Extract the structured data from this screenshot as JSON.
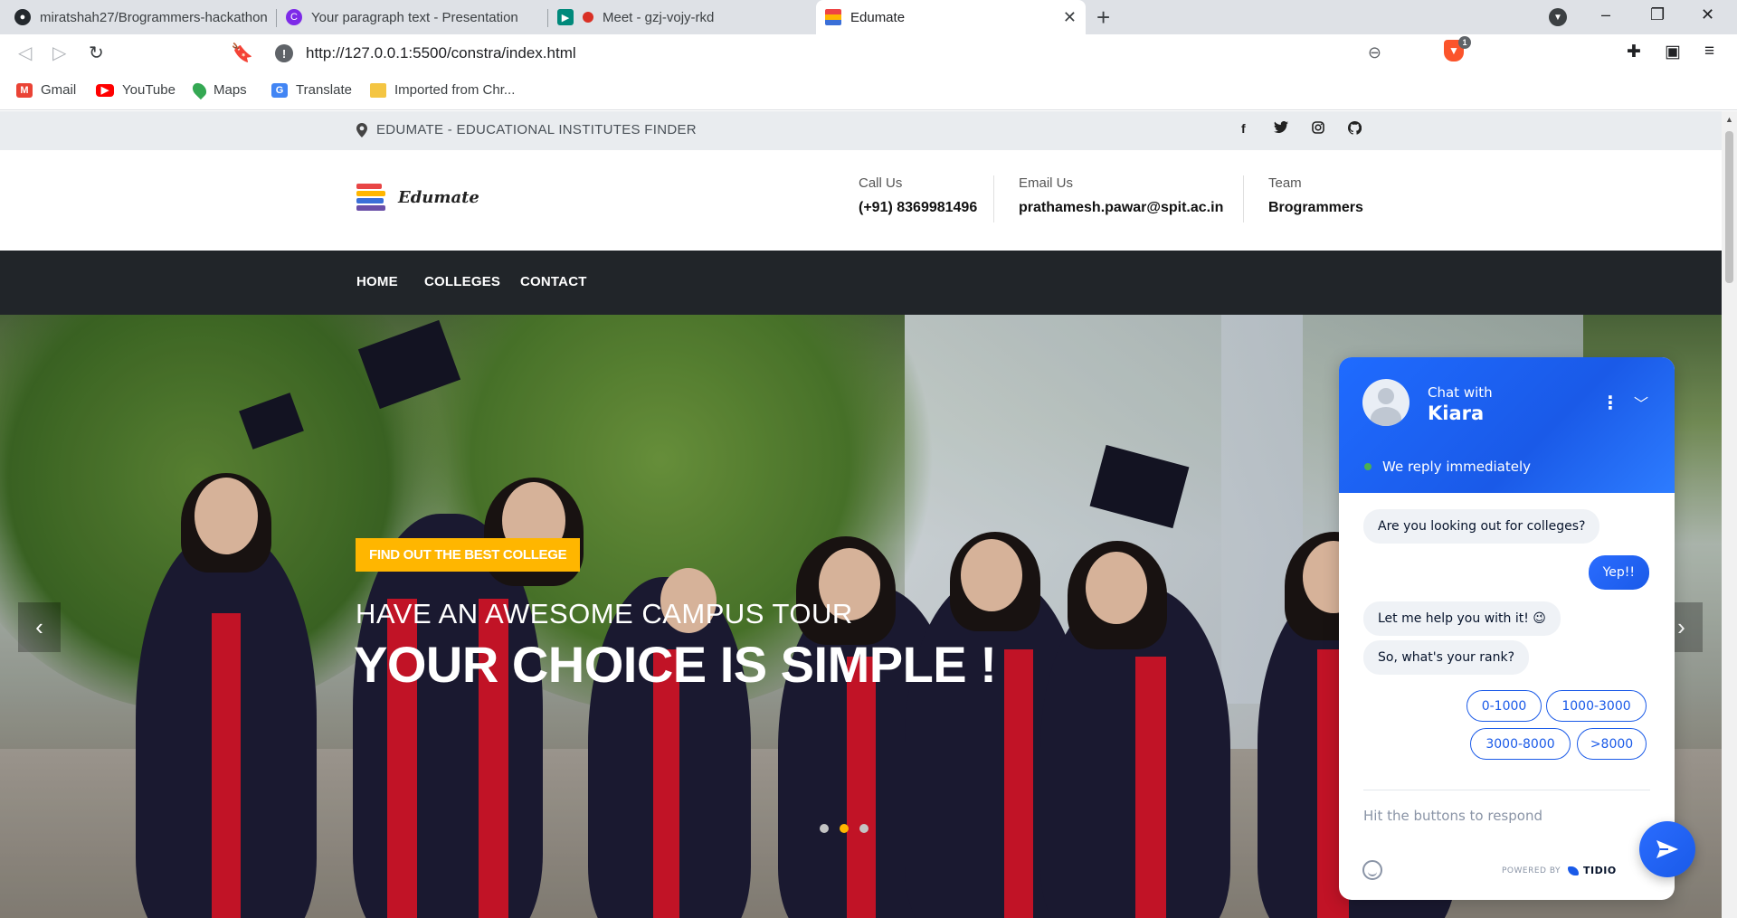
{
  "browser": {
    "tabs": [
      {
        "title": "miratshah27/Brogrammers-hackathon",
        "icon": "github-icon"
      },
      {
        "title": "Your paragraph text - Presentation",
        "icon": "canva-icon"
      },
      {
        "title": "Meet - gzj-vojy-rkd",
        "icon": "meet-icon"
      },
      {
        "title": "Edumate",
        "icon": "edumate-icon",
        "active": true
      }
    ],
    "new_tab": "+",
    "window_controls": {
      "minimize": "–",
      "restore": "❐",
      "close": "✕"
    },
    "url": "http://127.0.0.1:5500/constra/index.html",
    "extension_badge": "1",
    "bookmarks": [
      {
        "label": "Gmail",
        "icon": "gmail-icon",
        "color": "#ea4335"
      },
      {
        "label": "YouTube",
        "icon": "youtube-icon",
        "color": "#ff0000"
      },
      {
        "label": "Maps",
        "icon": "maps-icon",
        "color": "#34a853"
      },
      {
        "label": "Translate",
        "icon": "translate-icon",
        "color": "#4285f4"
      },
      {
        "label": "Imported from Chr...",
        "icon": "folder-icon",
        "color": "#f4c542"
      }
    ]
  },
  "site": {
    "topbar": {
      "location_text": "EDUMATE - EDUCATIONAL INSTITUTES FINDER",
      "social": [
        {
          "glyph": "f",
          "icon": "facebook-icon"
        },
        {
          "glyph": "🐦",
          "icon": "twitter-icon"
        },
        {
          "glyph": "◎",
          "icon": "instagram-icon"
        },
        {
          "glyph": "●",
          "icon": "github-icon"
        }
      ]
    },
    "header": {
      "logo_text": "Edumate",
      "call": {
        "label": "Call Us",
        "value": "(+91) 8369981496"
      },
      "email": {
        "label": "Email Us",
        "value": "prathamesh.pawar@spit.ac.in"
      },
      "team": {
        "label": "Team",
        "value": "Brogrammers"
      }
    },
    "nav": [
      "HOME",
      "COLLEGES",
      "CONTACT"
    ],
    "hero": {
      "badge": "FIND OUT THE BEST COLLEGE",
      "subtitle": "HAVE AN AWESOME CAMPUS TOUR",
      "title": "YOUR CHOICE IS SIMPLE !",
      "slide_count": 3,
      "active_slide": 2,
      "prev_arrow": "‹",
      "next_arrow": "›",
      "accent_color": "#ffb600"
    }
  },
  "chat": {
    "chat_with": "Chat with",
    "agent_name": "Kiara",
    "status": "We reply immediately",
    "messages": [
      {
        "from": "bot",
        "text": "Are you looking out for colleges?"
      },
      {
        "from": "user",
        "text": "Yep!!"
      },
      {
        "from": "bot",
        "text": "Let me help you with it! 😉"
      },
      {
        "from": "bot",
        "text": "So, what's your rank?"
      }
    ],
    "quick_replies": [
      "0-1000",
      "1000-3000",
      "3000-8000",
      ">8000"
    ],
    "input_placeholder": "Hit the buttons to respond",
    "powered_by": "POWERED BY",
    "brand": "TIDIO",
    "accent_color": "#1a5ae8"
  }
}
